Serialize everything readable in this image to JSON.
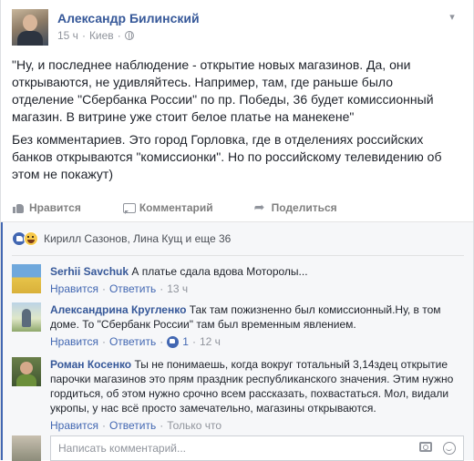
{
  "post": {
    "author": "Александр Билинский",
    "time": "15 ч",
    "location": "Киев",
    "paragraphs": [
      "\"Ну, и последнее наблюдение - открытие новых магазинов. Да, они открываются, не удивляйтесь. Например, там, где раньше было отделение \"Сбербанка России\" по пр. Победы, 36 будет комиссионный магазин. В витрине уже стоит белое платье на манекене\"",
      "Без комментариев. Это город Горловка, где в отделениях российских банков открываются \"комиссионки\". Но по российскому телевидению об этом не покажут)"
    ]
  },
  "actions": {
    "like": "Нравится",
    "comment": "Комментарий",
    "share": "Поделиться"
  },
  "reactions": {
    "summary": "Кирилл Сазонов, Лина Кущ и еще 36"
  },
  "comments": [
    {
      "author": "Serhii Savchuk",
      "text": "А платье сдала вдова Моторолы...",
      "like": "Нравится",
      "reply": "Ответить",
      "time": "13 ч"
    },
    {
      "author": "Александрина Кругленко",
      "text": "Так там пожизненно был комиссионный.Ну, в том доме. То \"Сбербанк России\" там был временным явлением.",
      "like": "Нравится",
      "reply": "Ответить",
      "likes_count": "1",
      "time": "12 ч"
    },
    {
      "author": "Роман Косенко",
      "text": "Ты не понимаешь, когда вокруг тотальный 3,14здец открытие парочки магазинов это прям праздник республиканского значения. Этим нужно гордиться, об этом нужно срочно всем рассказать, похвастаться. Мол, видали укропы, у нас всё просто замечательно, магазины открываются.",
      "like": "Нравится",
      "reply": "Ответить",
      "time": "Только что"
    }
  ],
  "write": {
    "placeholder": "Написать комментарий..."
  },
  "icons": {
    "privacy": "globe-icon",
    "menu": "chevron-down-icon",
    "like": "thumbs-up-icon",
    "comment": "speech-bubble-icon",
    "share": "share-arrow-icon",
    "camera": "camera-icon",
    "emoji": "smiley-icon"
  },
  "colors": {
    "link": "#365899",
    "accent": "#4267b2",
    "muted": "#90949c"
  }
}
